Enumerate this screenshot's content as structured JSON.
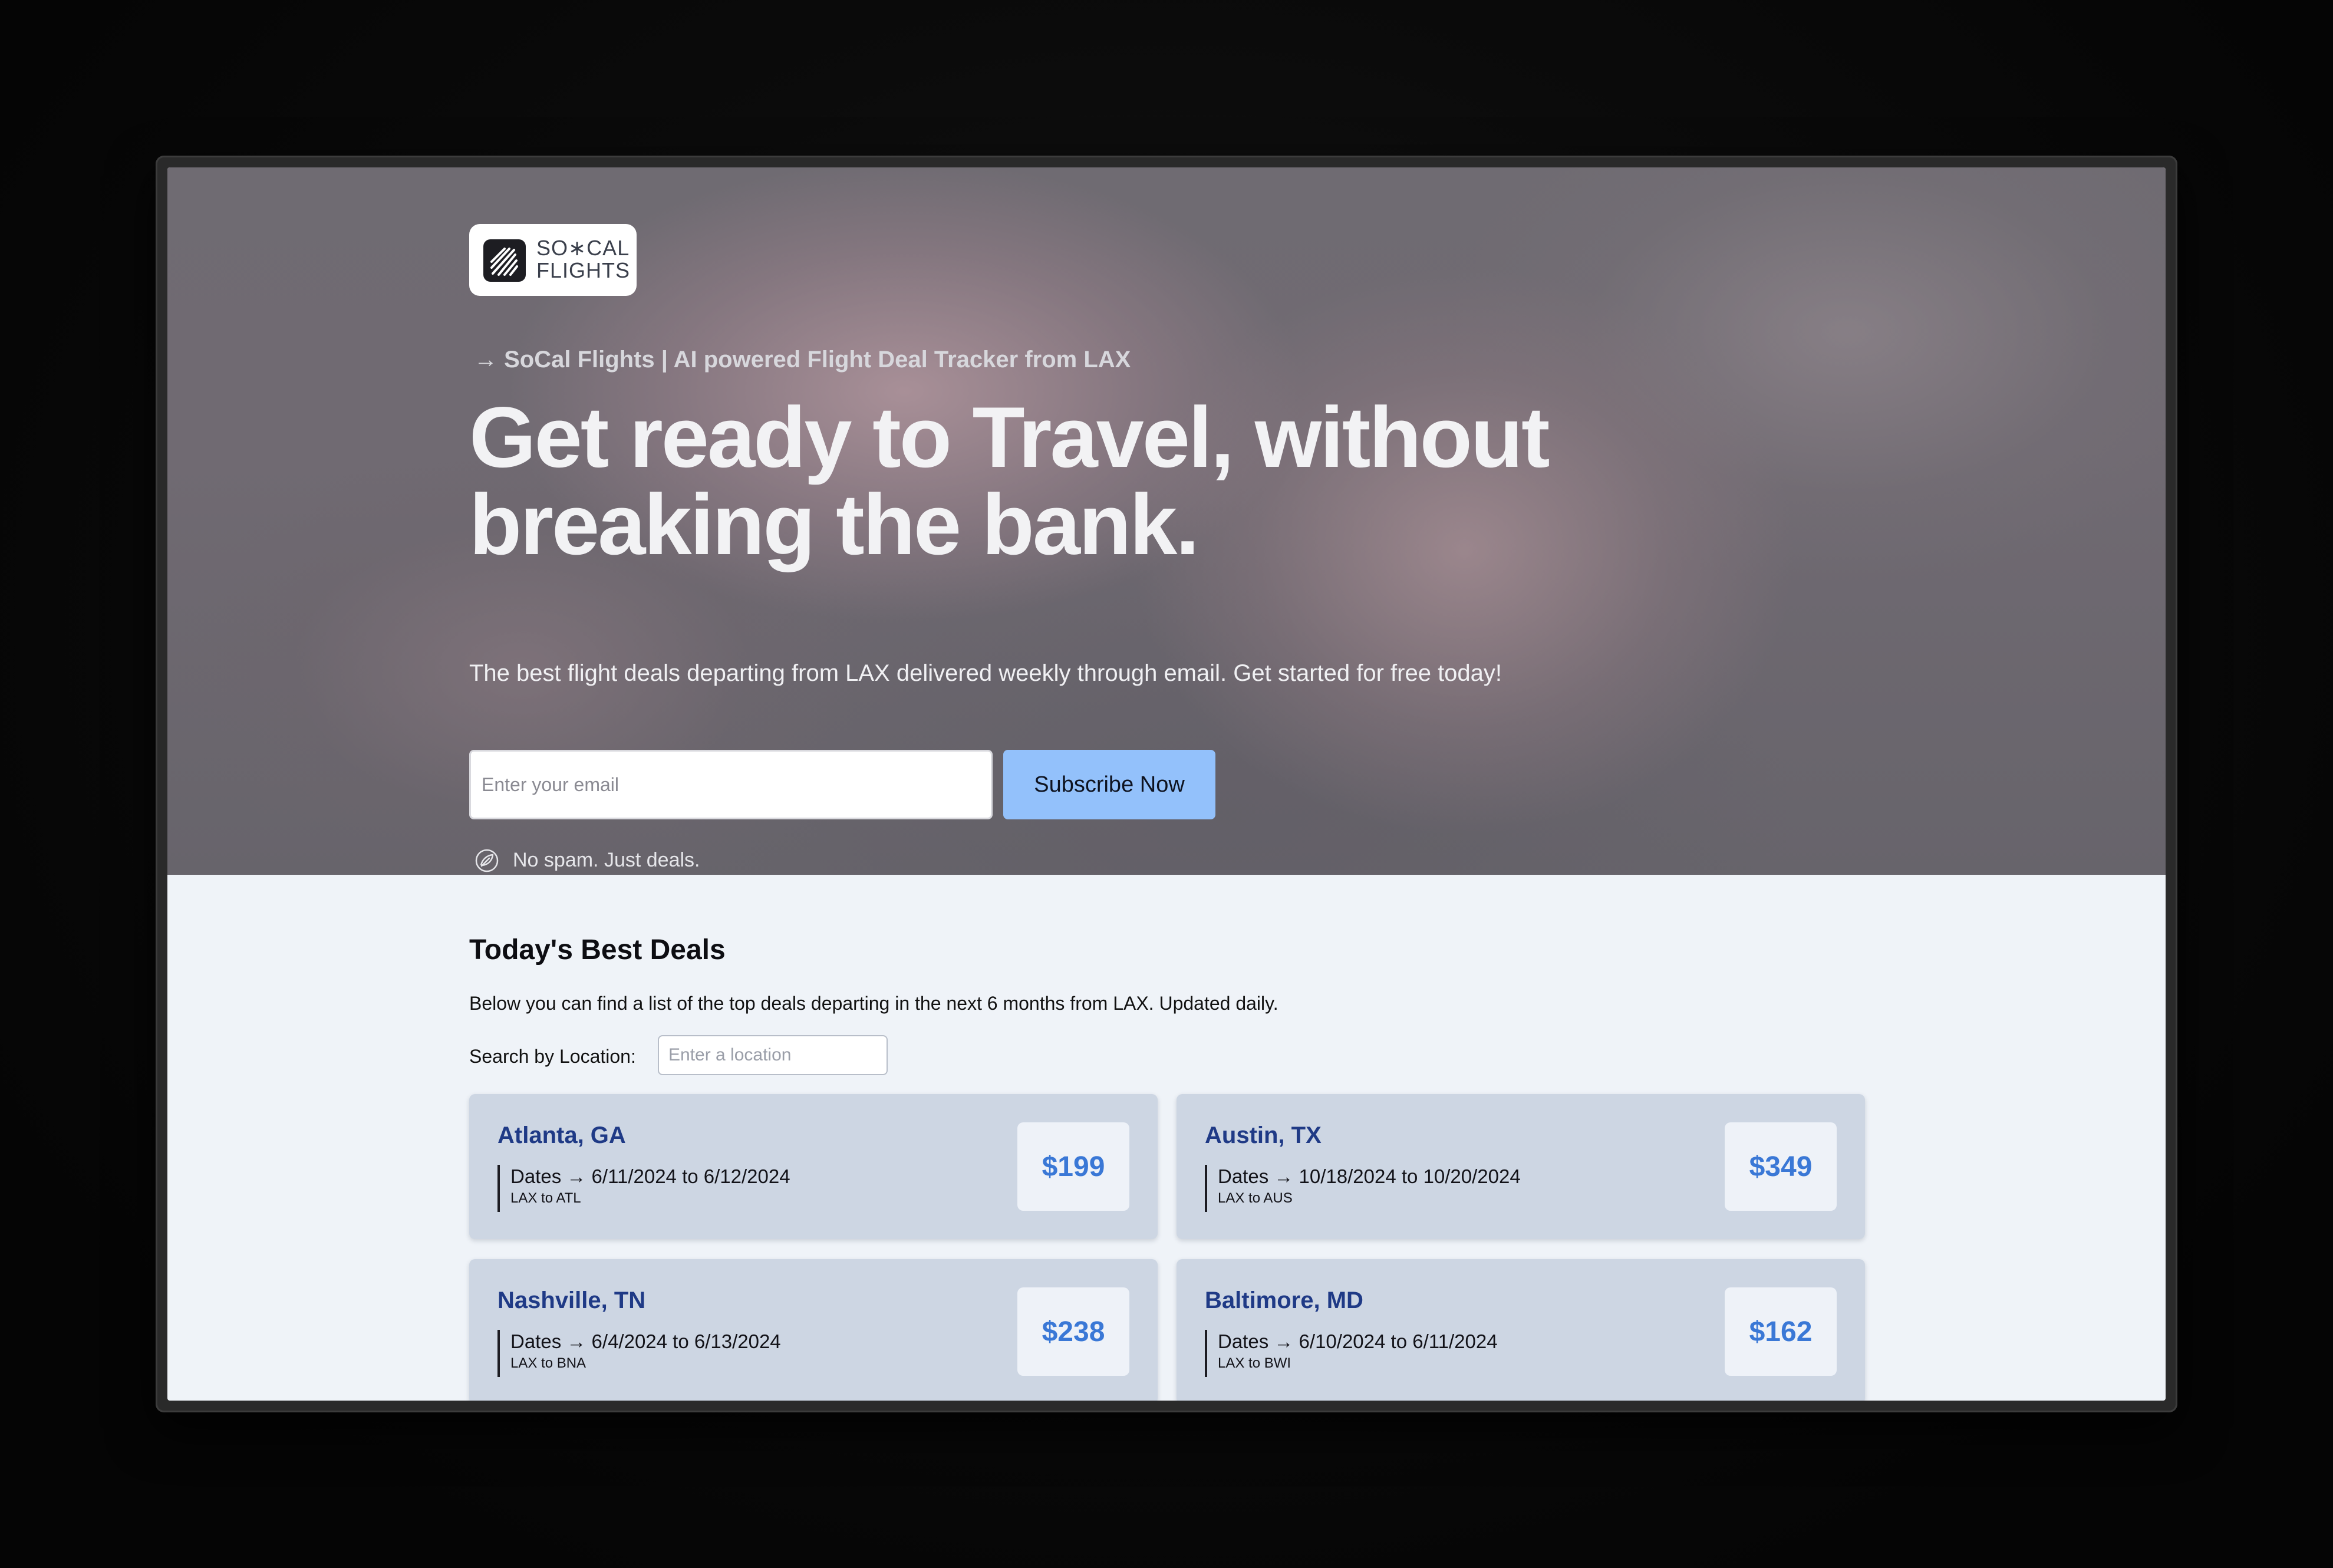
{
  "logo": {
    "line1": "SO∗CAL",
    "line2": "FLIGHTS"
  },
  "hero": {
    "tagline": "→ SoCal Flights | AI powered Flight Deal Tracker from LAX",
    "headline_line1": "Get ready to Travel, without",
    "headline_line2": "breaking the bank.",
    "subtitle": "The best flight deals departing from LAX delivered weekly through email. Get started for free today!",
    "email_placeholder": "Enter your email",
    "subscribe_label": "Subscribe Now",
    "nospam_text": "No spam. Just deals."
  },
  "deals": {
    "title": "Today's Best Deals",
    "description": "Below you can find a list of the top deals departing in the next 6 months from LAX. Updated daily.",
    "search_label": "Search by Location:",
    "search_placeholder": "Enter a location",
    "cards": [
      {
        "city": "Atlanta, GA",
        "dates": "Dates → 6/11/2024 to 6/12/2024",
        "route": "LAX to ATL",
        "price": "$199"
      },
      {
        "city": "Austin, TX",
        "dates": "Dates → 10/18/2024 to 10/20/2024",
        "route": "LAX to AUS",
        "price": "$349"
      },
      {
        "city": "Nashville, TN",
        "dates": "Dates → 6/4/2024 to 6/13/2024",
        "route": "LAX to BNA",
        "price": "$238"
      },
      {
        "city": "Baltimore, MD",
        "dates": "Dates → 6/10/2024 to 6/11/2024",
        "route": "LAX to BWI",
        "price": "$162"
      }
    ]
  },
  "colors": {
    "accent_button": "#93c1fb",
    "card_background": "#cdd6e3",
    "city_text": "#1f3a86",
    "price_text": "#3a78d6",
    "page_background": "#eff3f8"
  },
  "icons": {
    "logo": "flight-streaks-icon",
    "nospam": "leaf-circle-icon"
  }
}
